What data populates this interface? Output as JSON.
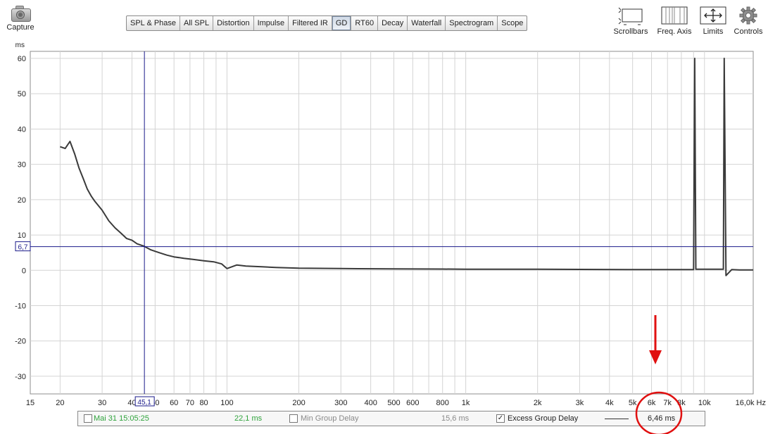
{
  "capture": {
    "label": "Capture"
  },
  "tabs": [
    {
      "label": "SPL & Phase"
    },
    {
      "label": "All SPL"
    },
    {
      "label": "Distortion"
    },
    {
      "label": "Impulse"
    },
    {
      "label": "Filtered IR"
    },
    {
      "label": "GD",
      "active": true
    },
    {
      "label": "RT60"
    },
    {
      "label": "Decay"
    },
    {
      "label": "Waterfall"
    },
    {
      "label": "Spectrogram"
    },
    {
      "label": "Scope"
    }
  ],
  "tools": {
    "scrollbars": "Scrollbars",
    "freq_axis": "Freq. Axis",
    "limits": "Limits",
    "controls": "Controls"
  },
  "cursor": {
    "x_label": "45,1",
    "y_label": "6,7"
  },
  "chart_data": {
    "type": "line",
    "ylabel": "ms",
    "xlabel": "Hz",
    "x_scale": "log",
    "xlim": [
      15,
      16000
    ],
    "ylim": [
      -35,
      62
    ],
    "yticks": [
      60,
      50,
      40,
      30,
      20,
      10,
      0,
      -10,
      -20,
      -30
    ],
    "xticks": [
      {
        "v": 15,
        "label": "15"
      },
      {
        "v": 20,
        "label": "20"
      },
      {
        "v": 30,
        "label": "30"
      },
      {
        "v": 40,
        "label": "40"
      },
      {
        "v": 50,
        "label": "50"
      },
      {
        "v": 60,
        "label": "60"
      },
      {
        "v": 70,
        "label": "70"
      },
      {
        "v": 80,
        "label": "80"
      },
      {
        "v": 100,
        "label": "100"
      },
      {
        "v": 200,
        "label": "200"
      },
      {
        "v": 300,
        "label": "300"
      },
      {
        "v": 400,
        "label": "400"
      },
      {
        "v": 500,
        "label": "500"
      },
      {
        "v": 600,
        "label": "600"
      },
      {
        "v": 800,
        "label": "800"
      },
      {
        "v": 1000,
        "label": "1k"
      },
      {
        "v": 2000,
        "label": "2k"
      },
      {
        "v": 3000,
        "label": "3k"
      },
      {
        "v": 4000,
        "label": "4k"
      },
      {
        "v": 5000,
        "label": "5k"
      },
      {
        "v": 6000,
        "label": "6k"
      },
      {
        "v": 7000,
        "label": "7k"
      },
      {
        "v": 8000,
        "label": "8k"
      },
      {
        "v": 10000,
        "label": "10k"
      },
      {
        "v": 16000,
        "label": "16,0k Hz"
      }
    ],
    "cursor": {
      "x": 45.1,
      "y": 6.7
    },
    "series": [
      {
        "name": "Excess Group Delay",
        "color": "#3a3a3a",
        "x": [
          20,
          21,
          22,
          23,
          24,
          25,
          26,
          27,
          28,
          30,
          32,
          34,
          36,
          38,
          40,
          42,
          45,
          48,
          52,
          56,
          60,
          66,
          72,
          80,
          88,
          95,
          100,
          110,
          120,
          140,
          160,
          200,
          300,
          500,
          800,
          1000,
          2000,
          3000,
          5000,
          7000,
          9000,
          9100,
          9200,
          12000,
          12100,
          12300,
          13000,
          14000,
          16000
        ],
        "y": [
          35,
          34.5,
          36.5,
          33,
          29,
          26,
          23,
          21,
          19.5,
          17,
          14,
          12,
          10.5,
          9,
          8.5,
          7.5,
          6.8,
          5.8,
          5,
          4.3,
          3.8,
          3.4,
          3.1,
          2.7,
          2.4,
          1.8,
          0.5,
          1.5,
          1.2,
          1,
          0.8,
          0.6,
          0.5,
          0.4,
          0.35,
          0.3,
          0.3,
          0.25,
          0.2,
          0.2,
          0.2,
          60,
          0.3,
          0.3,
          60,
          -1.5,
          0.2,
          0.1,
          0.1
        ]
      }
    ]
  },
  "status": {
    "item1_checked": false,
    "item1_label": "Mai 31 15:05:25",
    "item1_value": "22,1 ms",
    "item2_checked": false,
    "item2_label": "Min Group Delay",
    "item2_value": "15,6 ms",
    "item3_checked": true,
    "item3_label": "Excess Group Delay",
    "item3_value": "6,46 ms"
  }
}
